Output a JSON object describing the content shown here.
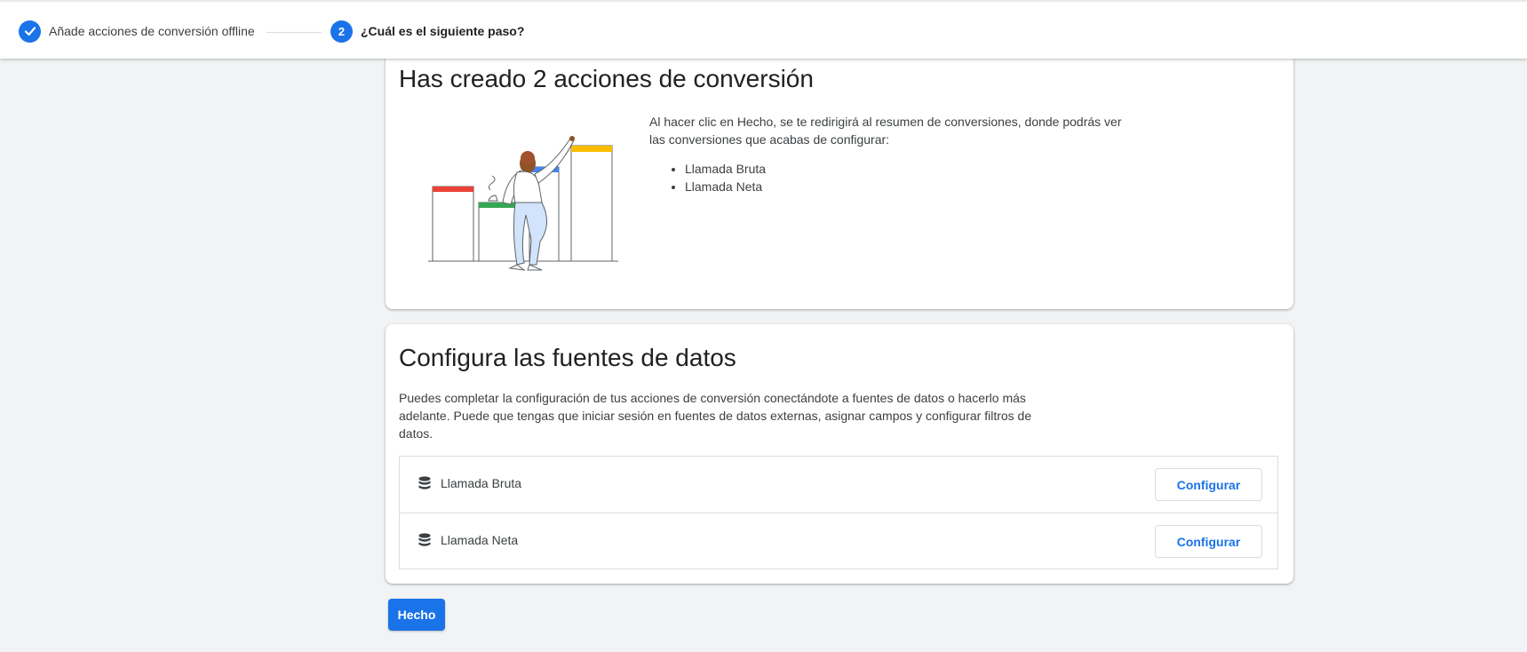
{
  "stepper": {
    "step1": {
      "label": "Añade acciones de conversión offline",
      "state": "completed"
    },
    "step2": {
      "number": "2",
      "label": "¿Cuál es el siguiente paso?",
      "state": "current"
    }
  },
  "created_card": {
    "title": "Has creado 2 acciones de conversión",
    "intro": "Al hacer clic en Hecho, se te redirigirá al resumen de conversiones, donde podrás ver las conversiones que acabas de configurar:",
    "conversions": [
      "Llamada Bruta",
      "Llamada Neta"
    ]
  },
  "sources_card": {
    "title": "Configura las fuentes de datos",
    "description": "Puedes completar la configuración de tus acciones de conversión conectándote a fuentes de datos o hacerlo más adelante. Puede que tengas que iniciar sesión en fuentes de datos externas, asignar campos y configurar filtros de datos.",
    "rows": [
      {
        "name": "Llamada Bruta",
        "button": "Configurar",
        "icon": "database-icon"
      },
      {
        "name": "Llamada Neta",
        "button": "Configurar",
        "icon": "database-icon"
      }
    ]
  },
  "done_button": "Hecho",
  "colors": {
    "accent": "#1a73e8",
    "background": "#f1f3f4"
  }
}
